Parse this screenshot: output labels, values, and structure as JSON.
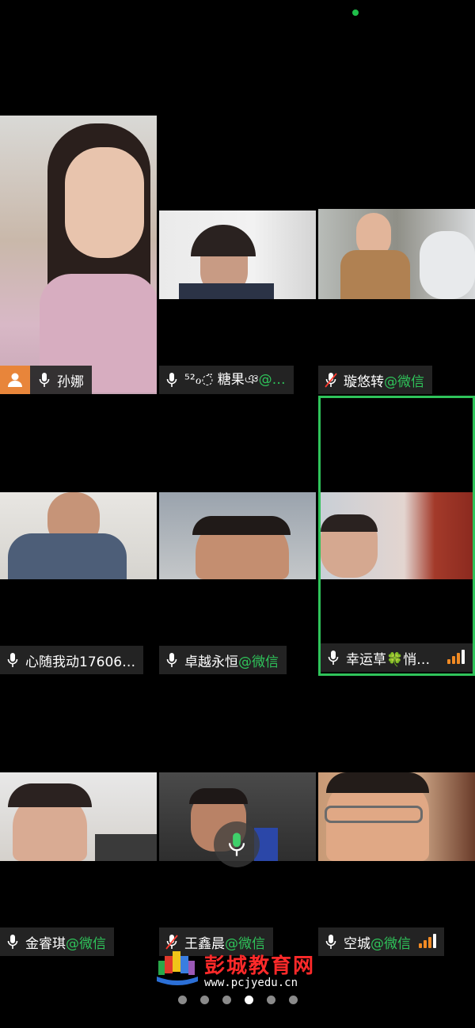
{
  "participants": [
    {
      "name": "孙娜",
      "suffix": "",
      "role": "host",
      "muted": false
    },
    {
      "name": "⁵²ℴ◌̈ 糖果ঞ",
      "suffix": "@…",
      "role": "member",
      "muted": false
    },
    {
      "name": "璇悠转",
      "suffix": "@微信",
      "role": "member",
      "muted": true
    },
    {
      "name": "心随我动17606…",
      "suffix": "",
      "role": "member",
      "muted": false
    },
    {
      "name": "卓越永恒",
      "suffix": "@微信",
      "role": "member",
      "muted": false
    },
    {
      "name": "幸运草🍀悄…",
      "suffix": "",
      "role": "member",
      "muted": false,
      "speaking": true,
      "signal": "strong"
    },
    {
      "name": "金睿琪",
      "suffix": "@微信",
      "role": "member",
      "muted": false
    },
    {
      "name": "王鑫晨",
      "suffix": "@微信",
      "role": "member",
      "muted": true
    },
    {
      "name": "空城",
      "suffix": "@微信",
      "role": "member",
      "muted": false,
      "signal": "strong"
    }
  ],
  "watermark": {
    "title": "彭城教育网",
    "url": "www.pcjyedu.cn"
  },
  "pager": {
    "total": 6,
    "current": 4
  },
  "colors": {
    "accent": "#2fc35a",
    "host_badge": "#e8853a",
    "signal": "#f08a24"
  },
  "icons": {
    "mic": "microphone-icon",
    "mic_off": "microphone-muted-icon",
    "host": "host-person-icon"
  }
}
